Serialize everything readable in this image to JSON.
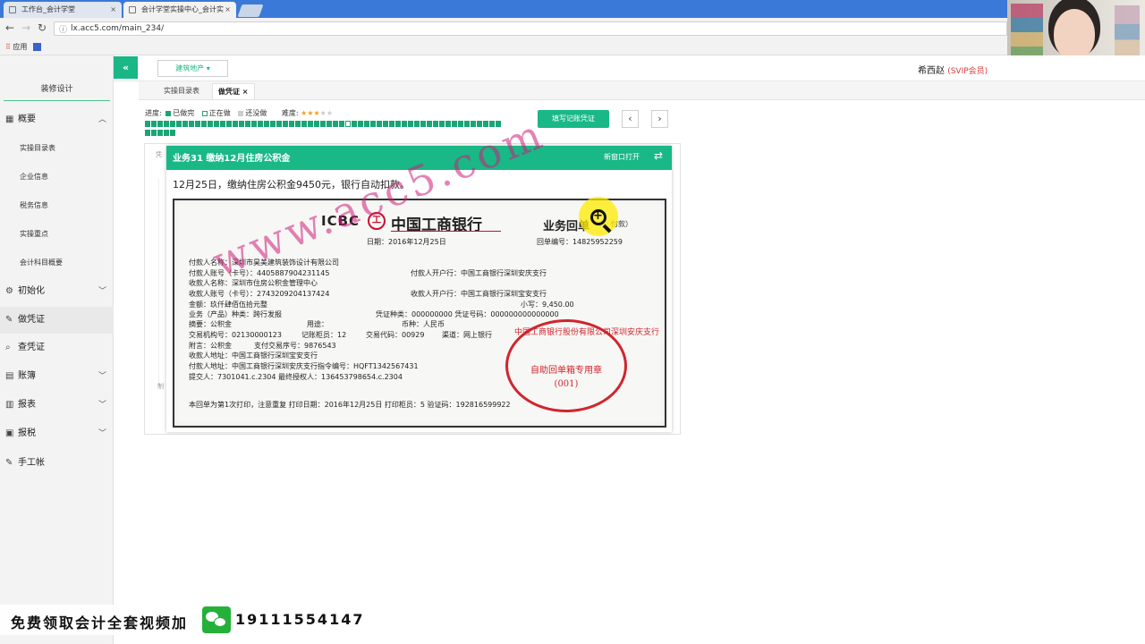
{
  "browser": {
    "tabs": [
      {
        "label": "工作台_会计学堂",
        "close": "×"
      },
      {
        "label": "会计学堂实操中心_会计实",
        "close": "×"
      }
    ],
    "url": "lx.acc5.com/main_234/",
    "bookmarks_label": "应用"
  },
  "header": {
    "collapse_label": "«",
    "industry_label": "建筑地产 ▾",
    "user_name": "希西赵",
    "user_badge": "(SVIP会员)"
  },
  "sidebar": {
    "title": "装修设计",
    "items": [
      {
        "label": "概要",
        "icon": "grid-icon",
        "arrow": "^"
      },
      {
        "label": "实操目录表"
      },
      {
        "label": "企业信息"
      },
      {
        "label": "税务信息"
      },
      {
        "label": "实操重点"
      },
      {
        "label": "会计科目概要"
      },
      {
        "label": "初始化",
        "icon": "gear-icon",
        "arrow": "v"
      },
      {
        "label": "做凭证",
        "icon": "pen-icon"
      },
      {
        "label": "查凭证",
        "icon": "search-icon"
      },
      {
        "label": "账簿",
        "icon": "book-icon",
        "arrow": "v"
      },
      {
        "label": "报表",
        "icon": "report-icon",
        "arrow": "v"
      },
      {
        "label": "报税",
        "icon": "tax-icon",
        "arrow": "v"
      },
      {
        "label": "手工帐",
        "icon": "pen-icon"
      }
    ]
  },
  "tabs": [
    {
      "label": "实操目录表"
    },
    {
      "label": "做凭证",
      "close": "×"
    }
  ],
  "progress": {
    "label": "进度:",
    "legend_done": "已做完",
    "legend_doing": "正在做",
    "legend_todo": "还没做",
    "difficulty_label": "难度:",
    "difficulty_level": 3,
    "difficulty_max": 5,
    "done_count": 62,
    "current_index": 32
  },
  "toolbar": {
    "fill_label": "填写记账凭证",
    "prev_label": "‹",
    "next_label": "›"
  },
  "voucher_behind": {
    "left_hint": "凭",
    "bottom_hint": "制"
  },
  "popup": {
    "title": "业务31  缴纳12月住房公积金",
    "new_window": "新窗口打开",
    "swap_icon": "⇄",
    "description": "12月25日，缴纳住房公积金9450元，银行自动扣款。"
  },
  "receipt": {
    "brand_en": "ICBC",
    "brand_logo": "工",
    "brand_cn": "中国工商银行",
    "title": "业务回单",
    "title_paren": "付款）",
    "date": "日期：2016年12月25日",
    "number": "回单编号：14825952259",
    "lines": [
      "付款人名称：深圳市昊美建筑装饰设计有限公司",
      "付款人账号（卡号）：4405887904231145",
      "付款人开户行：中国工商银行深圳安庆支行",
      "收款人名称：深圳市住房公积金管理中心",
      "收款人账号（卡号）：2743209204137424",
      "收款人开户行：中国工商银行深圳宝安支行",
      "金额：玖仟肆佰伍拾元整",
      "小写：9,450.00",
      "业务（产品）种类：跨行发报",
      "凭证种类：000000000  凭证号码：000000000000000",
      "摘要：公积金",
      "用途：",
      "币种：人民币",
      "交易机构号：02130000123",
      "记账柜员：12",
      "交易代码：00929",
      "渠道：网上银行",
      "附言：公积金",
      "支付交易序号：9876543",
      "收款人地址：中国工商银行深圳宝安支行",
      "付款人地址：中国工商银行深圳安庆支行指令编号：HQFT1342567431",
      "提交人：7301041.c.2304  最终授权人：136453798654.c.2304"
    ],
    "footer": "本回单为第1次打印，注意重复   打印日期：2016年12月25日   打印柜员：5   验证码：192816599922",
    "watermark": "www.acc5.com",
    "stamp_arc": "中国工商银行股份有限公司深圳安庆支行",
    "stamp_mid": "自助回单箱专用章",
    "stamp_num": "(001)"
  },
  "ad": {
    "text": "免费领取会计全套视频加",
    "phone": "19111554147"
  },
  "colors": {
    "accent": "#19b886",
    "brand_red": "#c8102e",
    "stamp_red": "#d0252e",
    "watermark": "#cd1e78"
  }
}
